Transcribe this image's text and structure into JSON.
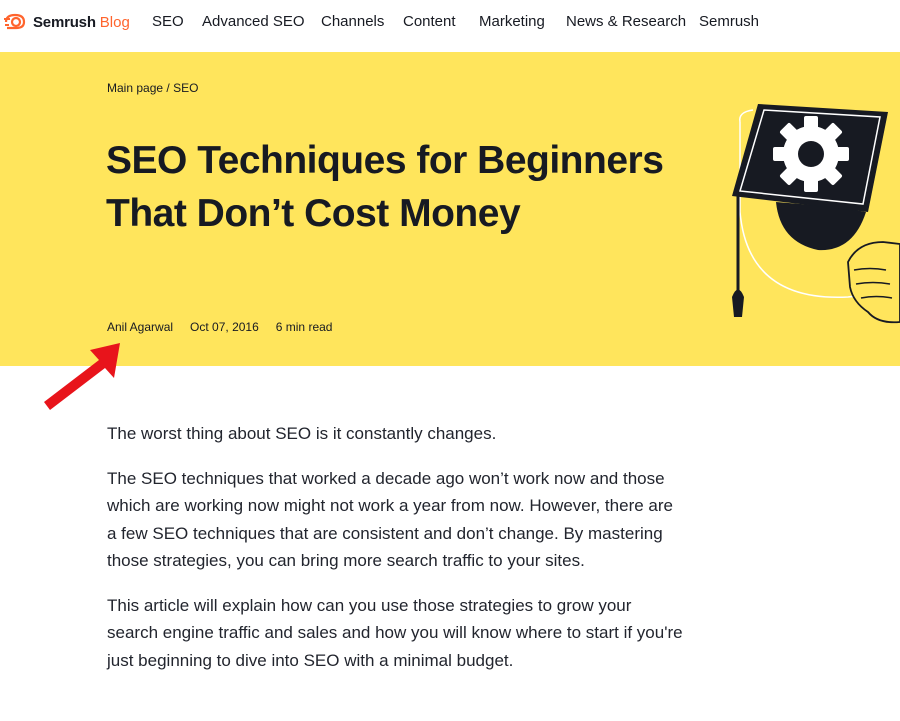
{
  "nav": {
    "logo_brand": "Semrush",
    "logo_blog": "Blog",
    "items": [
      "SEO",
      "Advanced SEO",
      "Channels",
      "Content",
      "Marketing",
      "News & Research",
      "Semrush"
    ]
  },
  "hero": {
    "breadcrumb": {
      "home": "Main page",
      "separator": "/",
      "section": "SEO"
    },
    "title": "SEO Techniques for Beginners That Don’t Cost Money",
    "author": "Anil Agarwal",
    "date": "Oct 07, 2016",
    "read_time": "6 min read"
  },
  "article": {
    "paragraphs": [
      "The worst thing about SEO is it constantly changes.",
      "The SEO techniques that worked a decade ago won’t work now and those which are working now might not work a year from now. However, there are a few SEO techniques that are consistent and don’t change. By mastering those strategies, you can bring more search traffic to your sites.",
      "This article will explain how can you use those strategies to grow your search engine traffic and sales and how you will know where to start if you're just beginning to dive into SEO with a minimal budget."
    ]
  },
  "colors": {
    "hero_bg": "#ffe55c",
    "brand_orange": "#ff642d",
    "arrow_red": "#e8141b"
  },
  "icons": {
    "logo": "semrush-flame-icon",
    "illustration": "graduation-cap-gear-icon",
    "annotation": "red-arrow-icon"
  }
}
